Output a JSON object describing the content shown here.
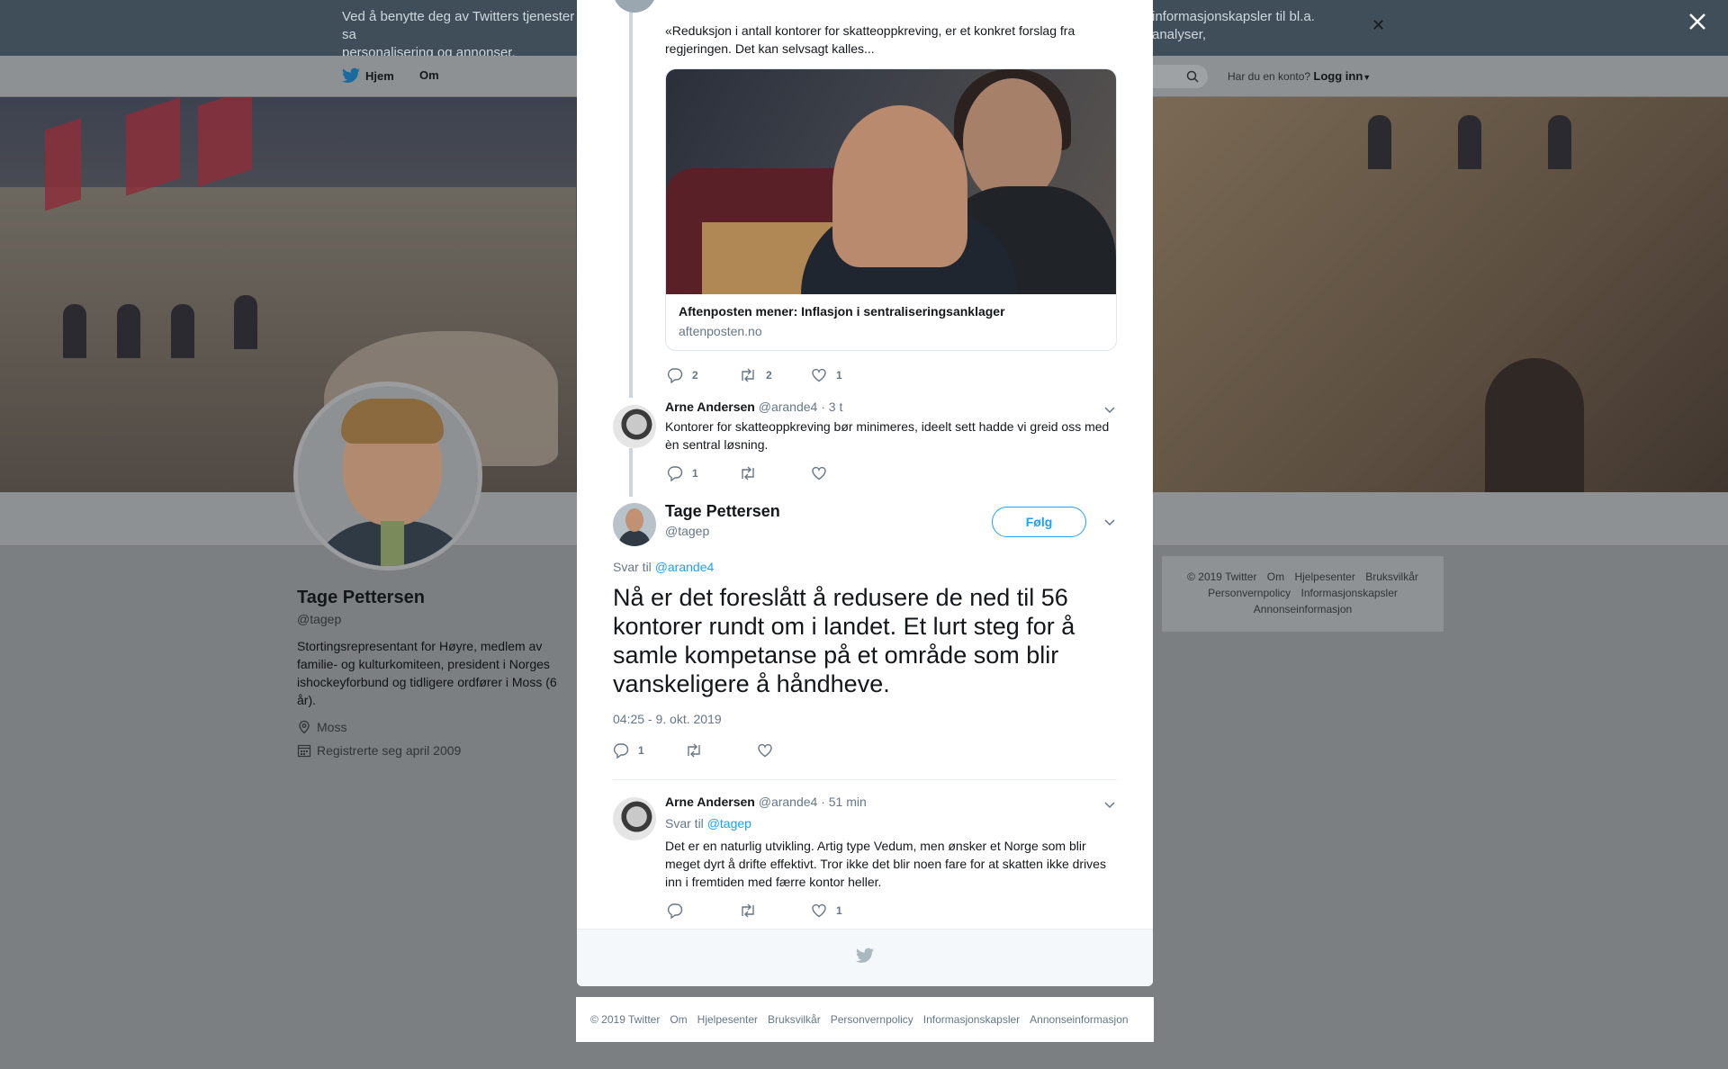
{
  "cookie_bar": {
    "text_left": "Ved å benytte deg av Twitters tjenester sa",
    "text_left_line2": "personalisering og annonser.",
    "text_right": "informasjonskapsler til bl.a. analyser,"
  },
  "topnav": {
    "home_label": "Hjem",
    "about_label": "Om",
    "account_question": "Har du en konto?",
    "login_label": "Logg inn"
  },
  "profile": {
    "name": "Tage Pettersen",
    "handle": "@tagep",
    "bio": "Stortingsrepresentant for Høyre, medlem av familie- og kulturkomiteen, president i Norges ishockeyforbund og tidligere ordfører i Moss (6 år).",
    "location": "Moss",
    "joined": "Registrerte seg april 2009"
  },
  "right_footer": {
    "links": [
      "© 2019 Twitter",
      "Om",
      "Hjelpesenter",
      "Bruksvilkår",
      "Personvernpolicy",
      "Informasjonskapsler",
      "Annonseinformasjon"
    ]
  },
  "thread": {
    "quote_text": "«Reduksjon i antall kontorer for skatteoppkreving, er et konkret forslag fra regjeringen. Det kan selvsagt kalles...",
    "card": {
      "title": "Aftenposten mener: Inflasjon i sentraliseringsanklager",
      "domain": "aftenposten.no"
    },
    "first_actions": {
      "replies": "2",
      "retweets": "2",
      "likes": "1"
    },
    "reply1": {
      "name": "Arne Andersen",
      "handle": "@arande4",
      "time": "· 3 t",
      "text": "Kontorer for skatteoppkreving bør minimeres, ideelt sett hadde vi greid oss med èn sentral løsning.",
      "replies": "1"
    },
    "main": {
      "name": "Tage Pettersen",
      "handle": "@tagep",
      "follow_label": "Følg",
      "reply_to_prefix": "Svar til",
      "reply_to_handle": "@arande4",
      "text": "Nå er det foreslått å redusere de ned til 56 kontorer rundt om i landet. Et lurt steg for å samle kompetanse på et område som blir vanskeligere å håndheve.",
      "timestamp": "04:25 - 9. okt. 2019",
      "replies": "1"
    },
    "reply2": {
      "name": "Arne Andersen",
      "handle": "@arande4",
      "time": "· 51 min",
      "reply_to_prefix": "Svar til",
      "reply_to_handle": "@tagep",
      "text": "Det er en naturlig utvikling. Artig type Vedum, men ønsker et Norge som blir meget dyrt å drifte effektivt. Tror ikke det blir noen fare for at skatten ikke drives inn i fremtiden med færre kontor heller.",
      "likes": "1"
    }
  },
  "bottom_footer": {
    "links": [
      "© 2019 Twitter",
      "Om",
      "Hjelpesenter",
      "Bruksvilkår",
      "Personvernpolicy",
      "Informasjonskapsler",
      "Annonseinformasjon"
    ]
  },
  "colors": {
    "accent": "#1da1f2",
    "muted": "#657786",
    "overlay": "#7c7f82"
  },
  "icons": [
    "twitter-bird-icon",
    "search-icon",
    "close-icon",
    "location-icon",
    "calendar-icon",
    "reply-icon",
    "retweet-icon",
    "like-icon",
    "chevron-down-icon"
  ]
}
